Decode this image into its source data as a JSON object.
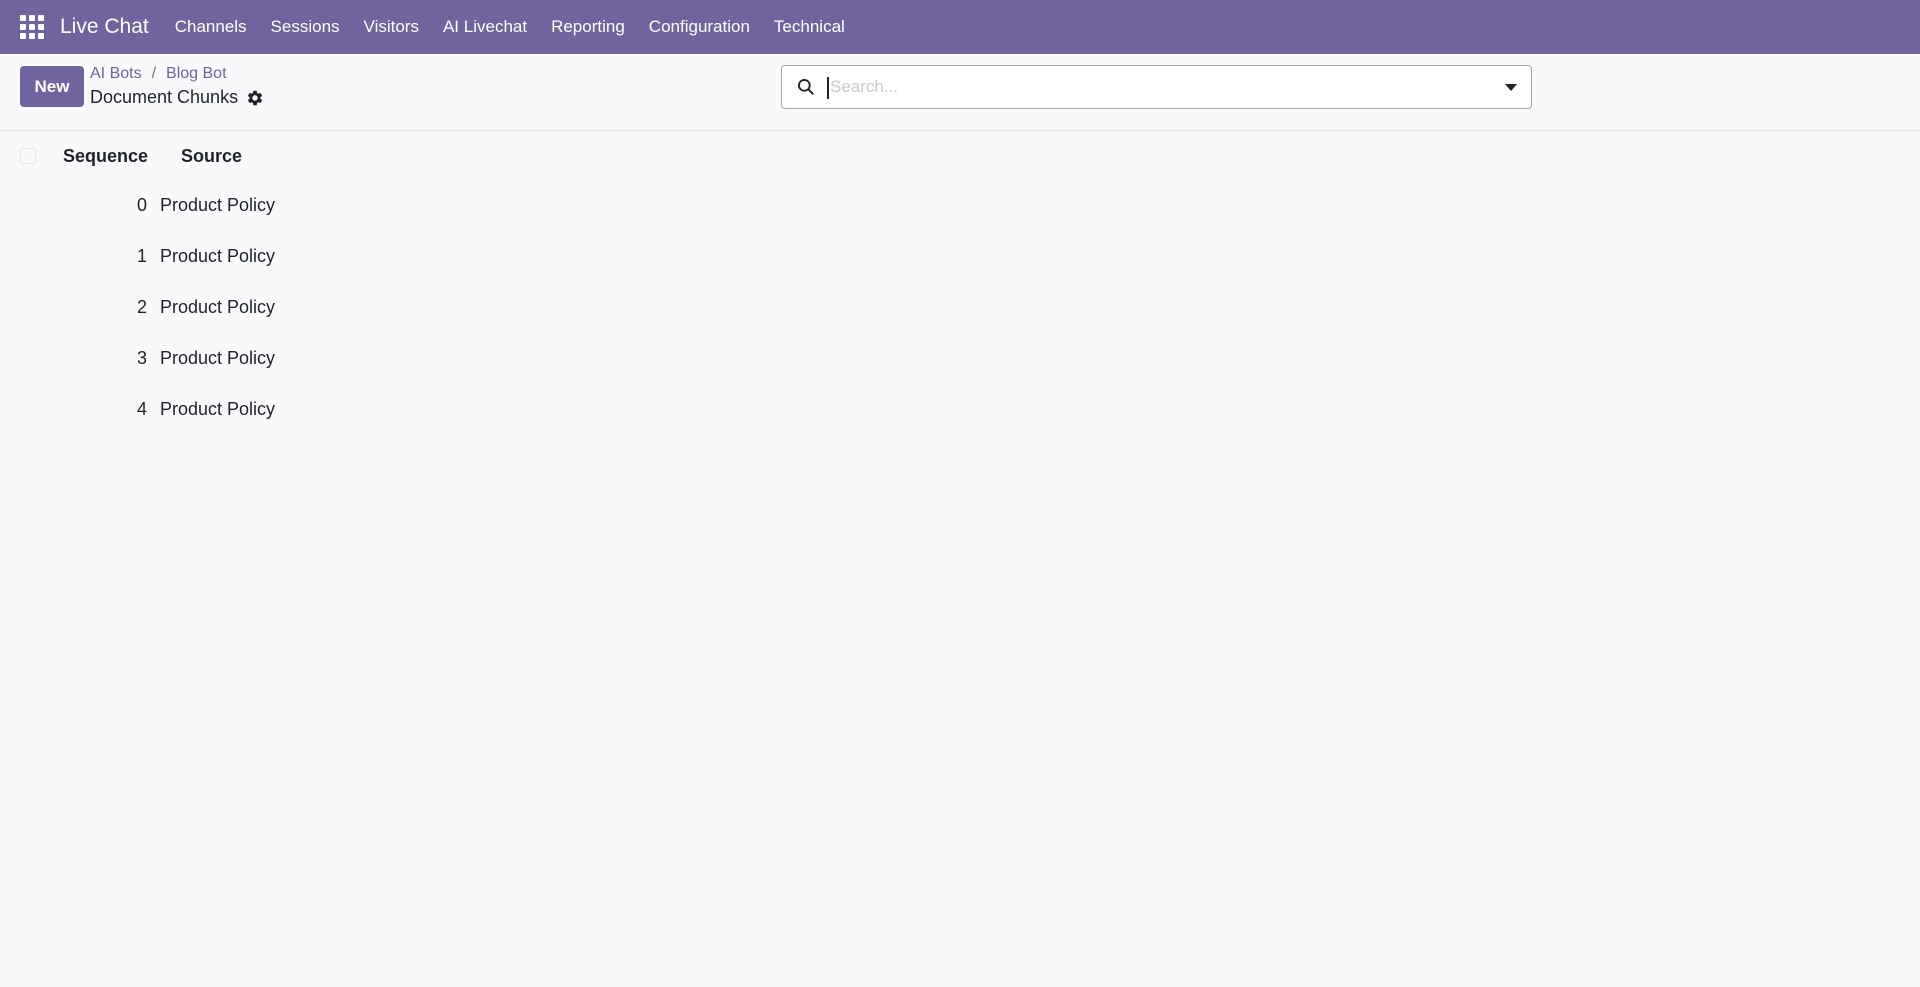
{
  "navbar": {
    "app_name": "Live Chat",
    "menu": [
      "Channels",
      "Sessions",
      "Visitors",
      "AI Livechat",
      "Reporting",
      "Configuration",
      "Technical"
    ],
    "color": "#71639e"
  },
  "control_panel": {
    "new_label": "New",
    "breadcrumb": [
      "AI Bots",
      "Blog Bot"
    ],
    "breadcrumb_separator": "/",
    "title": "Document Chunks"
  },
  "search": {
    "placeholder": "Search...",
    "value": ""
  },
  "list": {
    "columns": [
      "Sequence",
      "Source"
    ],
    "rows": [
      {
        "sequence": "0",
        "source": "Product Policy"
      },
      {
        "sequence": "1",
        "source": "Product Policy"
      },
      {
        "sequence": "2",
        "source": "Product Policy"
      },
      {
        "sequence": "3",
        "source": "Product Policy"
      },
      {
        "sequence": "4",
        "source": "Product Policy"
      }
    ]
  }
}
